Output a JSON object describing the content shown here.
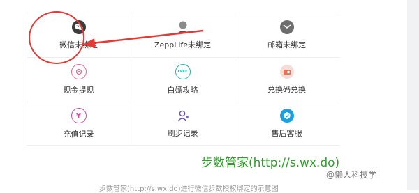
{
  "grid": {
    "items": [
      {
        "label": "微信未绑定",
        "icon": "wechat-icon"
      },
      {
        "label": "ZeppLife未绑定",
        "icon": "zepp-avatar-icon"
      },
      {
        "label": "邮箱未绑定",
        "icon": "mail-icon"
      },
      {
        "label": "现金提现",
        "icon": "cash-withdraw-icon"
      },
      {
        "label": "白嫖攻略",
        "icon": "free-icon",
        "icon_text": "FREE"
      },
      {
        "label": "兑换码兑换",
        "icon": "redeem-code-icon"
      },
      {
        "label": "充值记录",
        "icon": "yen-recharge-icon",
        "icon_text": "¥"
      },
      {
        "label": "刷步记录",
        "icon": "user-add-icon"
      },
      {
        "label": "售后客服",
        "icon": "customer-service-icon"
      }
    ]
  },
  "annotation": {
    "caption": "步数管家(http://s.wx.do)",
    "color_red": "#e53935",
    "color_green": "#2f9d2a"
  },
  "watermark": {
    "text": "@懒人科技学"
  },
  "footer": {
    "text": "步数管家(http://s.wx.do)进行微信步数授权绑定的示意图"
  }
}
